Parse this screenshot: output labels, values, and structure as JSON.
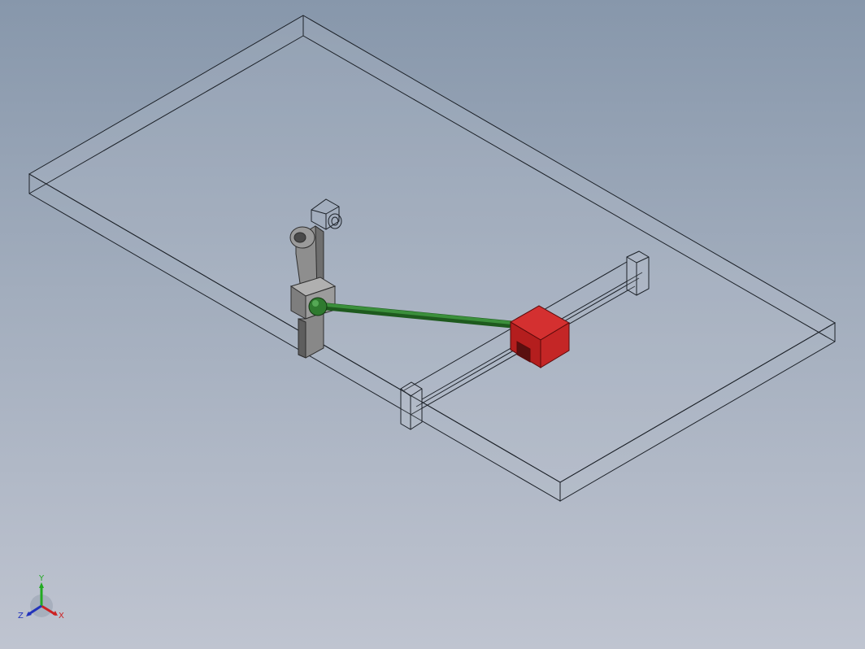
{
  "viewport": {
    "background_top": "#8797ab",
    "background_bottom": "#bfc4d0"
  },
  "model": {
    "plate": {
      "edge_color": "#1c2128",
      "fill": "#c8ced8"
    },
    "crank": {
      "color": "#8a8a8a",
      "outline": "#2e2e2e"
    },
    "connecting_rod": {
      "color": "#2f7a2f"
    },
    "slider": {
      "color": "#cc2222",
      "outline": "#5a0a0a"
    },
    "rail": {
      "edge_color": "#1c2128"
    }
  },
  "triad": {
    "x_label": "X",
    "y_label": "Y",
    "z_label": "Z",
    "x_color": "#cc2222",
    "y_color": "#22aa22",
    "z_color": "#2233bb"
  }
}
